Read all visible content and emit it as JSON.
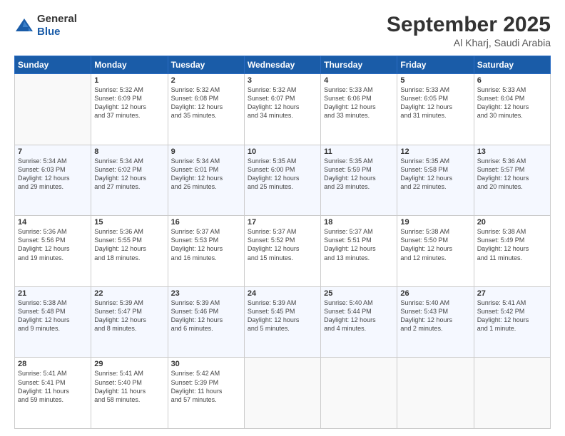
{
  "header": {
    "logo": {
      "general": "General",
      "blue": "Blue"
    },
    "title": "September 2025",
    "location": "Al Kharj, Saudi Arabia"
  },
  "days_of_week": [
    "Sunday",
    "Monday",
    "Tuesday",
    "Wednesday",
    "Thursday",
    "Friday",
    "Saturday"
  ],
  "weeks": [
    [
      {
        "day": "",
        "info": ""
      },
      {
        "day": "1",
        "info": "Sunrise: 5:32 AM\nSunset: 6:09 PM\nDaylight: 12 hours\nand 37 minutes."
      },
      {
        "day": "2",
        "info": "Sunrise: 5:32 AM\nSunset: 6:08 PM\nDaylight: 12 hours\nand 35 minutes."
      },
      {
        "day": "3",
        "info": "Sunrise: 5:32 AM\nSunset: 6:07 PM\nDaylight: 12 hours\nand 34 minutes."
      },
      {
        "day": "4",
        "info": "Sunrise: 5:33 AM\nSunset: 6:06 PM\nDaylight: 12 hours\nand 33 minutes."
      },
      {
        "day": "5",
        "info": "Sunrise: 5:33 AM\nSunset: 6:05 PM\nDaylight: 12 hours\nand 31 minutes."
      },
      {
        "day": "6",
        "info": "Sunrise: 5:33 AM\nSunset: 6:04 PM\nDaylight: 12 hours\nand 30 minutes."
      }
    ],
    [
      {
        "day": "7",
        "info": "Sunrise: 5:34 AM\nSunset: 6:03 PM\nDaylight: 12 hours\nand 29 minutes."
      },
      {
        "day": "8",
        "info": "Sunrise: 5:34 AM\nSunset: 6:02 PM\nDaylight: 12 hours\nand 27 minutes."
      },
      {
        "day": "9",
        "info": "Sunrise: 5:34 AM\nSunset: 6:01 PM\nDaylight: 12 hours\nand 26 minutes."
      },
      {
        "day": "10",
        "info": "Sunrise: 5:35 AM\nSunset: 6:00 PM\nDaylight: 12 hours\nand 25 minutes."
      },
      {
        "day": "11",
        "info": "Sunrise: 5:35 AM\nSunset: 5:59 PM\nDaylight: 12 hours\nand 23 minutes."
      },
      {
        "day": "12",
        "info": "Sunrise: 5:35 AM\nSunset: 5:58 PM\nDaylight: 12 hours\nand 22 minutes."
      },
      {
        "day": "13",
        "info": "Sunrise: 5:36 AM\nSunset: 5:57 PM\nDaylight: 12 hours\nand 20 minutes."
      }
    ],
    [
      {
        "day": "14",
        "info": "Sunrise: 5:36 AM\nSunset: 5:56 PM\nDaylight: 12 hours\nand 19 minutes."
      },
      {
        "day": "15",
        "info": "Sunrise: 5:36 AM\nSunset: 5:55 PM\nDaylight: 12 hours\nand 18 minutes."
      },
      {
        "day": "16",
        "info": "Sunrise: 5:37 AM\nSunset: 5:53 PM\nDaylight: 12 hours\nand 16 minutes."
      },
      {
        "day": "17",
        "info": "Sunrise: 5:37 AM\nSunset: 5:52 PM\nDaylight: 12 hours\nand 15 minutes."
      },
      {
        "day": "18",
        "info": "Sunrise: 5:37 AM\nSunset: 5:51 PM\nDaylight: 12 hours\nand 13 minutes."
      },
      {
        "day": "19",
        "info": "Sunrise: 5:38 AM\nSunset: 5:50 PM\nDaylight: 12 hours\nand 12 minutes."
      },
      {
        "day": "20",
        "info": "Sunrise: 5:38 AM\nSunset: 5:49 PM\nDaylight: 12 hours\nand 11 minutes."
      }
    ],
    [
      {
        "day": "21",
        "info": "Sunrise: 5:38 AM\nSunset: 5:48 PM\nDaylight: 12 hours\nand 9 minutes."
      },
      {
        "day": "22",
        "info": "Sunrise: 5:39 AM\nSunset: 5:47 PM\nDaylight: 12 hours\nand 8 minutes."
      },
      {
        "day": "23",
        "info": "Sunrise: 5:39 AM\nSunset: 5:46 PM\nDaylight: 12 hours\nand 6 minutes."
      },
      {
        "day": "24",
        "info": "Sunrise: 5:39 AM\nSunset: 5:45 PM\nDaylight: 12 hours\nand 5 minutes."
      },
      {
        "day": "25",
        "info": "Sunrise: 5:40 AM\nSunset: 5:44 PM\nDaylight: 12 hours\nand 4 minutes."
      },
      {
        "day": "26",
        "info": "Sunrise: 5:40 AM\nSunset: 5:43 PM\nDaylight: 12 hours\nand 2 minutes."
      },
      {
        "day": "27",
        "info": "Sunrise: 5:41 AM\nSunset: 5:42 PM\nDaylight: 12 hours\nand 1 minute."
      }
    ],
    [
      {
        "day": "28",
        "info": "Sunrise: 5:41 AM\nSunset: 5:41 PM\nDaylight: 11 hours\nand 59 minutes."
      },
      {
        "day": "29",
        "info": "Sunrise: 5:41 AM\nSunset: 5:40 PM\nDaylight: 11 hours\nand 58 minutes."
      },
      {
        "day": "30",
        "info": "Sunrise: 5:42 AM\nSunset: 5:39 PM\nDaylight: 11 hours\nand 57 minutes."
      },
      {
        "day": "",
        "info": ""
      },
      {
        "day": "",
        "info": ""
      },
      {
        "day": "",
        "info": ""
      },
      {
        "day": "",
        "info": ""
      }
    ]
  ]
}
